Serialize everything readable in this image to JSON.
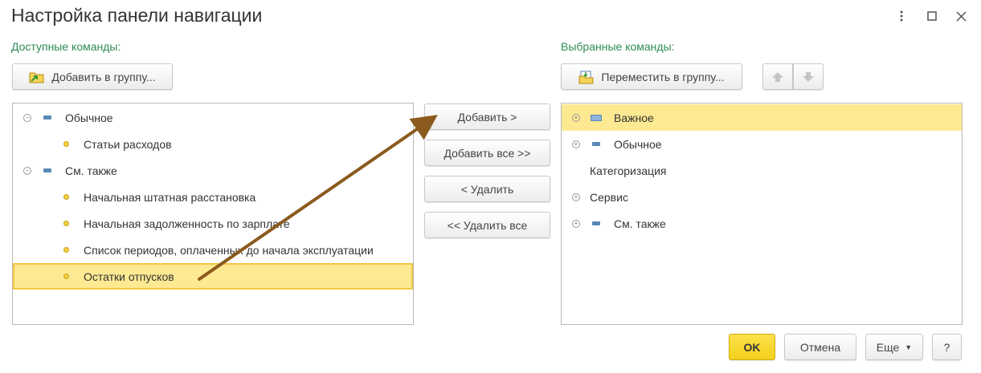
{
  "window": {
    "title": "Настройка панели навигации"
  },
  "left": {
    "label": "Доступные команды:",
    "add_to_group_button": "Добавить в группу...",
    "tree": [
      {
        "label": "Обычное",
        "kind": "group",
        "expanded": true
      },
      {
        "label": "Статьи расходов",
        "kind": "item"
      },
      {
        "label": "См. также",
        "kind": "group",
        "expanded": true
      },
      {
        "label": "Начальная штатная расстановка",
        "kind": "item"
      },
      {
        "label": "Начальная задолженность по зарплате",
        "kind": "item"
      },
      {
        "label": "Список периодов, оплаченных до начала эксплуатации",
        "kind": "item"
      },
      {
        "label": "Остатки отпусков",
        "kind": "item",
        "selected": true
      }
    ]
  },
  "middle": {
    "add": "Добавить >",
    "add_all": "Добавить все >>",
    "remove": "< Удалить",
    "remove_all": "<< Удалить все"
  },
  "right": {
    "label": "Выбранные команды:",
    "move_to_group_button": "Переместить в группу...",
    "tree": [
      {
        "label": "Важное",
        "kind": "group",
        "expanded": false,
        "selected": true
      },
      {
        "label": "Обычное",
        "kind": "group",
        "expanded": false
      },
      {
        "label": "Категоризация",
        "kind": "plain"
      },
      {
        "label": "Сервис",
        "kind": "group-noicon",
        "expanded": false
      },
      {
        "label": "См. также",
        "kind": "group",
        "expanded": false
      }
    ]
  },
  "footer": {
    "ok": "OK",
    "cancel": "Отмена",
    "more": "Еще",
    "help": "?"
  },
  "colors": {
    "accent_label": "#2e8b57",
    "selection": "#fde992",
    "ok_button": "#f2cf1c",
    "annotation_arrow": "#8b5a1e"
  }
}
